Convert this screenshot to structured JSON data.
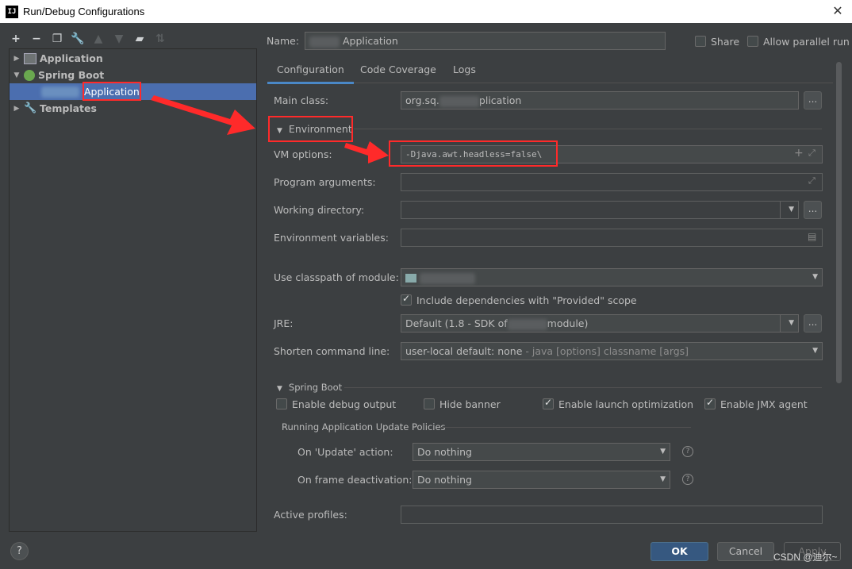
{
  "window": {
    "title": "Run/Debug Configurations",
    "app_icon": "IJ"
  },
  "tree": {
    "items": [
      {
        "label": "Application",
        "icon": "application-icon"
      },
      {
        "label": "Spring Boot",
        "icon": "spring-boot-icon"
      },
      {
        "label": "Application",
        "icon": "spring-boot-app-icon"
      },
      {
        "label": "Templates",
        "icon": "wrench-icon"
      }
    ]
  },
  "header": {
    "name_label": "Name:",
    "name_value": "Application",
    "share_label": "Share",
    "parallel_label": "Allow parallel run"
  },
  "tabs": [
    "Configuration",
    "Code Coverage",
    "Logs"
  ],
  "form": {
    "main_class_label": "Main class:",
    "main_class_prefix": "org.sq.",
    "main_class_suffix": "plication",
    "environment_label": "Environment",
    "vm_options_label": "VM options:",
    "vm_options_value": "-Djava.awt.headless=false\\",
    "program_args_label": "Program arguments:",
    "working_dir_label": "Working directory:",
    "env_vars_label": "Environment variables:",
    "classpath_label": "Use classpath of module:",
    "include_deps_label": "Include dependencies with \"Provided\" scope",
    "jre_label": "JRE:",
    "jre_value_prefix": "Default (1.8 - SDK of",
    "jre_value_suffix": "module)",
    "shorten_label": "Shorten command line:",
    "shorten_value_main": "user-local default: none",
    "shorten_value_hint": " - java [options] classname [args]"
  },
  "spring_boot": {
    "section_label": "Spring Boot",
    "debug_output_label": "Enable debug output",
    "hide_banner_label": "Hide banner",
    "launch_opt_label": "Enable launch optimization",
    "jmx_label": "Enable JMX agent",
    "policies_label": "Running Application Update Policies",
    "on_update_label": "On 'Update' action:",
    "on_update_value": "Do nothing",
    "on_frame_label": "On frame deactivation:",
    "on_frame_value": "Do nothing",
    "active_profiles_label": "Active profiles:"
  },
  "buttons": {
    "help": "?",
    "ok": "OK",
    "cancel": "Cancel",
    "apply": "Apply"
  },
  "watermark": "CSDN @迪尔~",
  "colors": {
    "background": "#3c3f41",
    "selection": "#4b6eaf",
    "accent": "#4a88c7",
    "annotation_red": "#ff2a2a"
  }
}
